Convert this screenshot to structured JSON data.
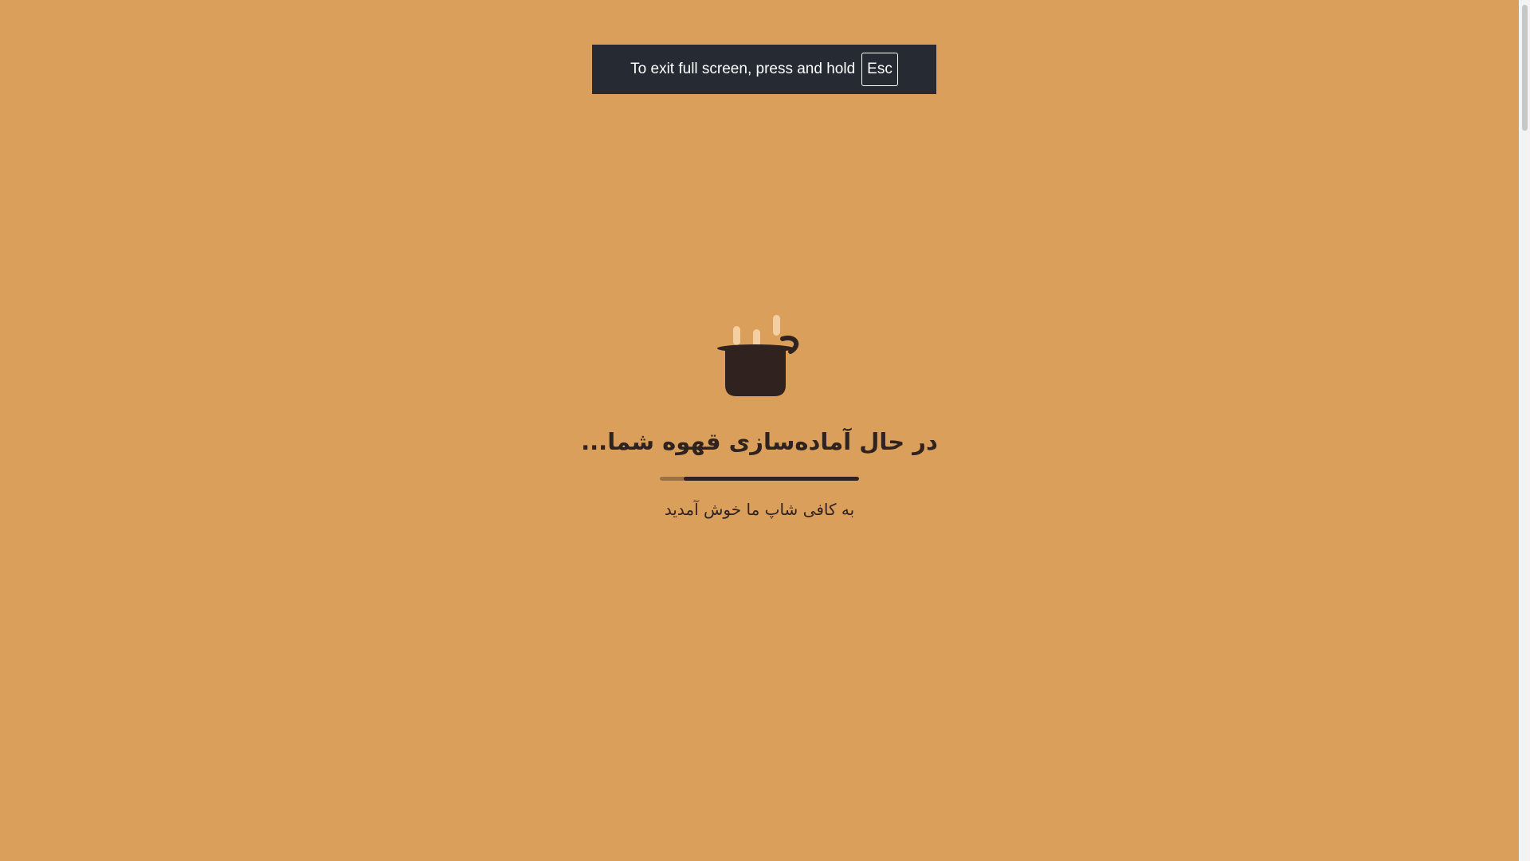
{
  "fullscreen_notice": {
    "text": "To exit full screen, press and hold",
    "key": "Esc"
  },
  "loader": {
    "title": "در حال آماده‌سازی قهوه شما...",
    "subtitle": "به کافی شاپ ما خوش آمدید",
    "progress": 0.88,
    "icon": "coffee-pot-icon"
  },
  "colors": {
    "background": "#DAA05B",
    "text_dark": "#2F221F",
    "steam": "#F3CFA2",
    "progress_track": "#9C7148",
    "notice_bg": "#262A33"
  }
}
